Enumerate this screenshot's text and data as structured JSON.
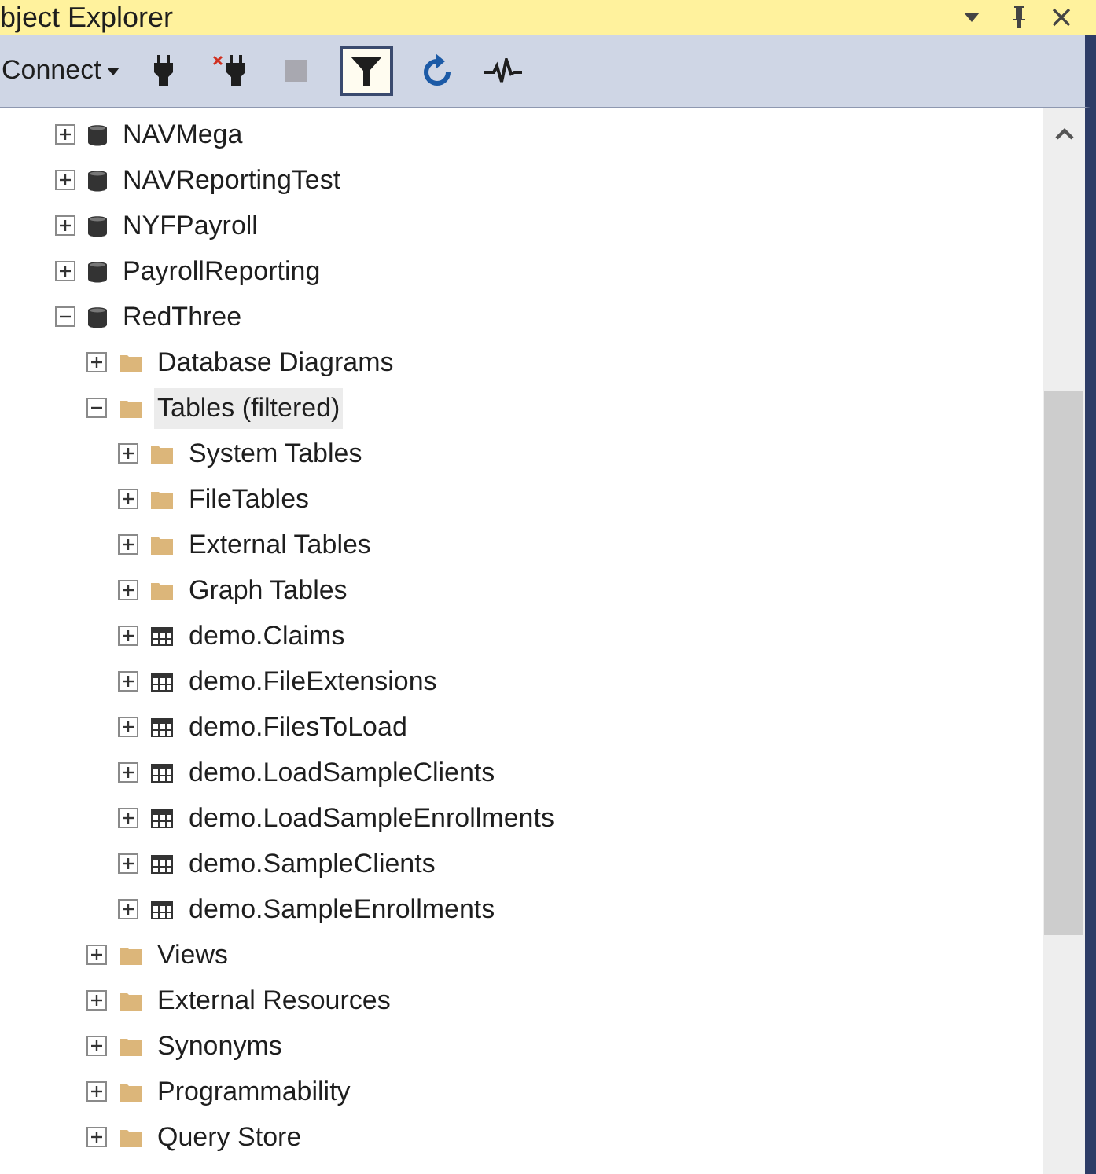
{
  "window": {
    "title": "bject Explorer"
  },
  "toolbar": {
    "connect": {
      "label": "Connect"
    },
    "buttons": [
      {
        "kind": "plug",
        "disabled": false,
        "on": false
      },
      {
        "kind": "disconnect",
        "disabled": false,
        "on": false
      },
      {
        "kind": "stop",
        "disabled": true,
        "on": false
      },
      {
        "kind": "filter",
        "disabled": false,
        "on": true
      },
      {
        "kind": "refresh",
        "disabled": false,
        "on": false
      },
      {
        "kind": "activity",
        "disabled": false,
        "on": false
      }
    ]
  },
  "tree": [
    {
      "kind": "database",
      "label": "NAVMega",
      "expanded": false,
      "selected": false
    },
    {
      "kind": "database",
      "label": "NAVReportingTest",
      "expanded": false,
      "selected": false
    },
    {
      "kind": "database",
      "label": "NYFPayroll",
      "expanded": false,
      "selected": false
    },
    {
      "kind": "database",
      "label": "PayrollReporting",
      "expanded": false,
      "selected": false
    },
    {
      "kind": "database",
      "label": "RedThree",
      "expanded": true,
      "selected": false,
      "children": [
        {
          "kind": "folder",
          "label": "Database Diagrams",
          "expanded": false,
          "selected": false
        },
        {
          "kind": "folder",
          "label": "Tables (filtered)",
          "expanded": true,
          "selected": true,
          "children": [
            {
              "kind": "folder",
              "label": "System Tables",
              "expanded": false,
              "selected": false
            },
            {
              "kind": "folder",
              "label": "FileTables",
              "expanded": false,
              "selected": false
            },
            {
              "kind": "folder",
              "label": "External Tables",
              "expanded": false,
              "selected": false
            },
            {
              "kind": "folder",
              "label": "Graph Tables",
              "expanded": false,
              "selected": false
            },
            {
              "kind": "table",
              "label": "demo.Claims",
              "expanded": false,
              "selected": false
            },
            {
              "kind": "table",
              "label": "demo.FileExtensions",
              "expanded": false,
              "selected": false
            },
            {
              "kind": "table",
              "label": "demo.FilesToLoad",
              "expanded": false,
              "selected": false
            },
            {
              "kind": "table",
              "label": "demo.LoadSampleClients",
              "expanded": false,
              "selected": false
            },
            {
              "kind": "table",
              "label": "demo.LoadSampleEnrollments",
              "expanded": false,
              "selected": false
            },
            {
              "kind": "table",
              "label": "demo.SampleClients",
              "expanded": false,
              "selected": false
            },
            {
              "kind": "table",
              "label": "demo.SampleEnrollments",
              "expanded": false,
              "selected": false
            }
          ]
        },
        {
          "kind": "folder",
          "label": "Views",
          "expanded": false,
          "selected": false
        },
        {
          "kind": "folder",
          "label": "External Resources",
          "expanded": false,
          "selected": false
        },
        {
          "kind": "folder",
          "label": "Synonyms",
          "expanded": false,
          "selected": false
        },
        {
          "kind": "folder",
          "label": "Programmability",
          "expanded": false,
          "selected": false
        },
        {
          "kind": "folder",
          "label": "Query Store",
          "expanded": false,
          "selected": false
        }
      ]
    }
  ]
}
